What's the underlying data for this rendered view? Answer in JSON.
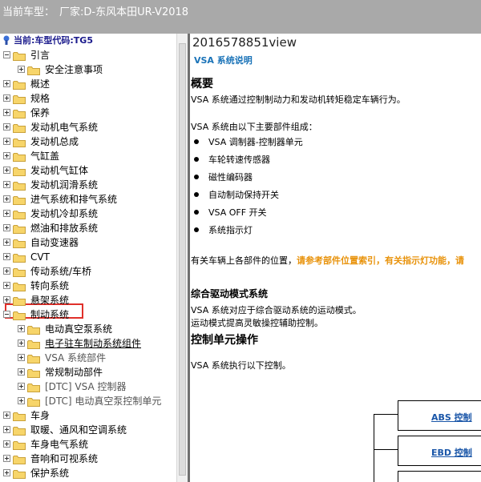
{
  "header": {
    "label": "当前车型：",
    "vehicle": "厂家:D-东风本田UR-V2018"
  },
  "tree": {
    "root_label": "当前:车型代码:TG5",
    "items": [
      {
        "label": "引言",
        "expander": "minus",
        "level": 0
      },
      {
        "label": "安全注意事项",
        "expander": "plus",
        "level": 1
      },
      {
        "label": "概述",
        "expander": "plus",
        "level": 0
      },
      {
        "label": "规格",
        "expander": "plus",
        "level": 0
      },
      {
        "label": "保养",
        "expander": "plus",
        "level": 0
      },
      {
        "label": "发动机电气系统",
        "expander": "plus",
        "level": 0
      },
      {
        "label": "发动机总成",
        "expander": "plus",
        "level": 0
      },
      {
        "label": "气缸盖",
        "expander": "plus",
        "level": 0
      },
      {
        "label": "发动机气缸体",
        "expander": "plus",
        "level": 0
      },
      {
        "label": "发动机润滑系统",
        "expander": "plus",
        "level": 0
      },
      {
        "label": "进气系统和排气系统",
        "expander": "plus",
        "level": 0
      },
      {
        "label": "发动机冷却系统",
        "expander": "plus",
        "level": 0
      },
      {
        "label": "燃油和排放系统",
        "expander": "plus",
        "level": 0
      },
      {
        "label": "自动变速器",
        "expander": "plus",
        "level": 0
      },
      {
        "label": "CVT",
        "expander": "plus",
        "level": 0
      },
      {
        "label": "传动系统/车桥",
        "expander": "plus",
        "level": 0
      },
      {
        "label": "转向系统",
        "expander": "plus",
        "level": 0
      },
      {
        "label": "悬架系统",
        "expander": "plus",
        "level": 0
      },
      {
        "label": "制动系统",
        "expander": "minus",
        "level": 0,
        "highlight": true
      },
      {
        "label": "电动真空泵系统",
        "expander": "plus",
        "level": 1
      },
      {
        "label": "电子驻车制动系统组件",
        "expander": "plus",
        "level": 1,
        "underline": true
      },
      {
        "label": "VSA 系统部件",
        "expander": "plus",
        "level": 1,
        "gray": true
      },
      {
        "label": "常规制动部件",
        "expander": "plus",
        "level": 1
      },
      {
        "label": "[DTC] VSA 控制器",
        "expander": "plus",
        "level": 1,
        "gray": true
      },
      {
        "label": "[DTC] 电动真空泵控制单元",
        "expander": "plus",
        "level": 1,
        "gray": true
      },
      {
        "label": "车身",
        "expander": "plus",
        "level": 0
      },
      {
        "label": "取暖、通风和空调系统",
        "expander": "plus",
        "level": 0
      },
      {
        "label": "车身电气系统",
        "expander": "plus",
        "level": 0
      },
      {
        "label": "音响和可视系统",
        "expander": "plus",
        "level": 0
      },
      {
        "label": "保护系统",
        "expander": "plus",
        "level": 0
      }
    ]
  },
  "content": {
    "doc_id": "2016578851view",
    "doc_subtitle": "VSA 系统说明",
    "overview_heading": "概要",
    "overview_text": "VSA 系统通过控制制动力和发动机转矩稳定车辆行为。",
    "components_intro": "VSA 系统由以下主要部件组成：",
    "components": [
      "VSA 调制器-控制器单元",
      "车轮转速传感器",
      "磁性编码器",
      "自动制动保持开关",
      "VSA OFF 开关",
      "系统指示灯"
    ],
    "location_text": "有关车辆上各部件的位置，",
    "location_link": "请参考部件位置索引，有关指示灯功能，请",
    "drive_mode_heading": "综合驱动模式系统",
    "drive_mode_text1": "VSA 系统对应于综合驱动系统的运动模式。",
    "drive_mode_text2": "运动模式提高灵敏操控辅助控制。",
    "control_heading": "控制单元操作",
    "control_text": "VSA 系统执行以下控制。",
    "diagram_links": [
      "ABS 控制",
      "EBD 控制"
    ]
  }
}
